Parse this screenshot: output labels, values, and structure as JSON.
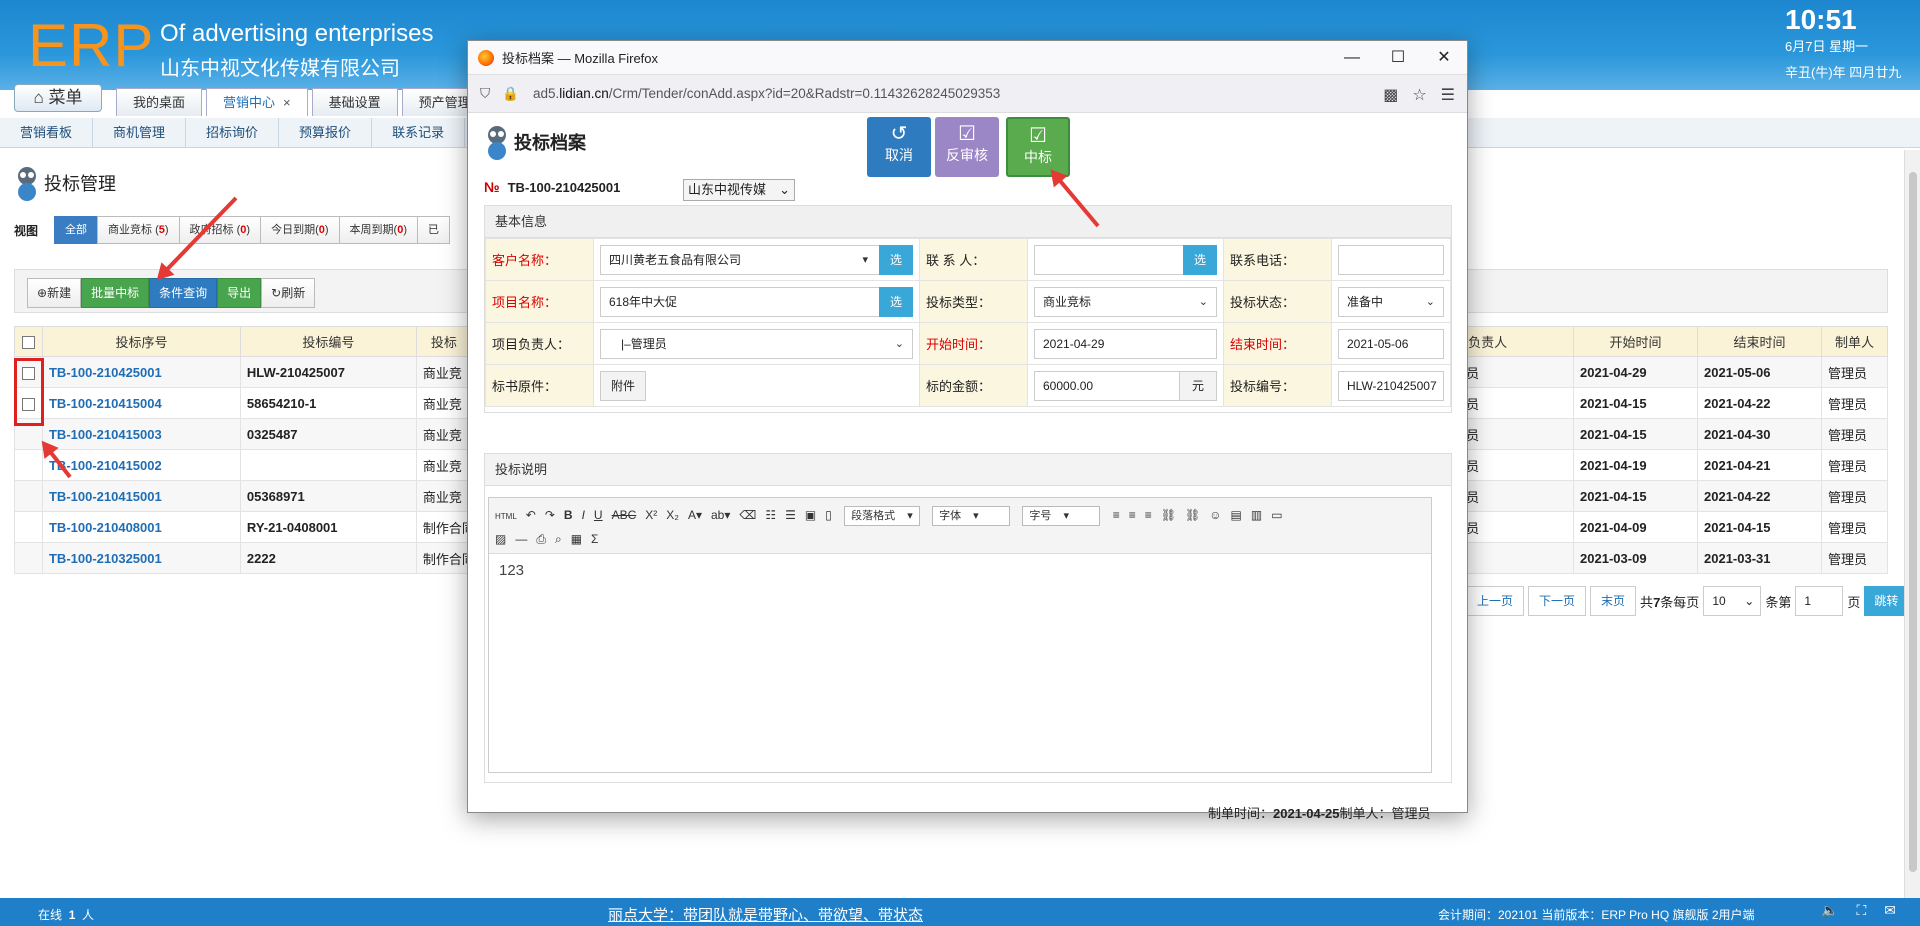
{
  "header": {
    "logo": "ERP",
    "title1": "Of advertising enterprises",
    "title2": "山东中视文化传媒有限公司",
    "clock": "10:51",
    "date1": "6月7日 星期一",
    "date2": "辛丑(牛)年 四月廿九"
  },
  "menu_button": "菜单",
  "tabs": [
    {
      "label": "我的桌面"
    },
    {
      "label": "营销中心",
      "close": "×"
    },
    {
      "label": "基础设置"
    },
    {
      "label": "预产管理"
    }
  ],
  "subnav": [
    "营销看板",
    "商机管理",
    "招标询价",
    "预算报价",
    "联系记录"
  ],
  "page_title": "投标管理",
  "view": {
    "label": "视图",
    "buttons": [
      {
        "label": "全部"
      },
      {
        "label": "商业竞标",
        "count": "5"
      },
      {
        "label": "政府招标",
        "count": "0"
      },
      {
        "label": "今日到期",
        "count": "0"
      },
      {
        "label": "本周到期",
        "count": "0"
      },
      {
        "label": "已"
      }
    ]
  },
  "toolbar": {
    "new": "新建",
    "batch_win": "批量中标",
    "query": "条件查询",
    "export": "导出",
    "refresh": "刷新"
  },
  "grid": {
    "headers": [
      "投标序号",
      "投标编号",
      "投标",
      "负责人",
      "开始时间",
      "结束时间",
      "制单人"
    ],
    "rows": [
      {
        "no": "TB-100-210425001",
        "code": "HLW-210425007",
        "type": "商业竞",
        "owner": "员",
        "start": "2021-04-29",
        "end": "2021-05-06",
        "maker": "管理员"
      },
      {
        "no": "TB-100-210415004",
        "code": "58654210-1",
        "type": "商业竞",
        "owner": "员",
        "start": "2021-04-15",
        "end": "2021-04-22",
        "maker": "管理员"
      },
      {
        "no": "TB-100-210415003",
        "code": "0325487",
        "type": "商业竞",
        "owner": "员",
        "start": "2021-04-15",
        "end": "2021-04-30",
        "maker": "管理员"
      },
      {
        "no": "TB-100-210415002",
        "code": "",
        "type": "商业竞",
        "owner": "员",
        "start": "2021-04-19",
        "end": "2021-04-21",
        "maker": "管理员"
      },
      {
        "no": "TB-100-210415001",
        "code": "05368971",
        "type": "商业竞",
        "owner": "员",
        "start": "2021-04-15",
        "end": "2021-04-22",
        "maker": "管理员"
      },
      {
        "no": "TB-100-210408001",
        "code": "RY-21-0408001",
        "type": "制作合同",
        "owner": "员",
        "start": "2021-04-09",
        "end": "2021-04-15",
        "maker": "管理员"
      },
      {
        "no": "TB-100-210325001",
        "code": "2222",
        "type": "制作合同",
        "owner": "",
        "start": "2021-03-09",
        "end": "2021-03-31",
        "maker": "管理员"
      }
    ]
  },
  "pager": {
    "prev": "上一页",
    "next": "下一页",
    "last": "末页",
    "total_pre": "共",
    "total": "7",
    "total_post": "条每页",
    "per_page": "10",
    "page_pre": "条第",
    "page": "1",
    "page_post": "页",
    "jump": "跳转"
  },
  "footer": {
    "online_label": "在线",
    "online_count": "1",
    "online_unit": "人",
    "slogan": "丽点大学：带团队就是带野心、带欲望、带状态",
    "period": "会计期间：202101 当前版本：ERP Pro HQ 旗舰版 2用户端"
  },
  "modal": {
    "window_title": "投标档案 — Mozilla Firefox",
    "url_pre": "ad5.",
    "url_domain": "lidian.cn",
    "url_post": "/Crm/Tender/conAdd.aspx?id=20&Radstr=0.11432628245029353",
    "heading": "投标档案",
    "buttons": {
      "cancel": "取消",
      "unreview": "反审核",
      "win": "中标"
    },
    "no_symbol": "№",
    "doc_no": "TB-100-210425001",
    "company": "山东中视传媒",
    "basic_title": "基本信息",
    "labels": {
      "customer": "客户名称：",
      "contact": "联 系 人：",
      "phone": "联系电话：",
      "project": "项目名称：",
      "bid_type": "投标类型：",
      "bid_status": "投标状态：",
      "owner": "项目负责人：",
      "start": "开始时间：",
      "end": "结束时间：",
      "doc": "标书原件：",
      "amount": "标的金额：",
      "bid_code": "投标编号："
    },
    "values": {
      "customer": "四川黄老五食品有限公司",
      "contact": "",
      "phone": "",
      "project": "618年中大促",
      "bid_type": "商业竞标",
      "bid_status": "准备中",
      "owner": "|–管理员",
      "start": "2021-04-29",
      "end": "2021-05-06",
      "attach": "附件",
      "amount": "60000.00",
      "yuan": "元",
      "bid_code": "HLW-210425007",
      "pick": "选"
    },
    "desc_title": "投标说明",
    "editor": {
      "para": "段落格式",
      "font": "字体",
      "size": "字号",
      "text": "123"
    },
    "footer_label1": "制单时间：",
    "footer_time": "2021-04-25",
    "footer_label2": "制单人：",
    "footer_maker": "管理员"
  },
  "colors": {
    "header_blue": "#1d86cf",
    "orange_logo": "#f7941d",
    "green": "#49a54d",
    "blue_btn": "#2f7bbf",
    "purple_btn": "#9b86c6",
    "link": "#1f6eb5",
    "required_red": "#d00000",
    "arrow_red": "#e53935"
  }
}
